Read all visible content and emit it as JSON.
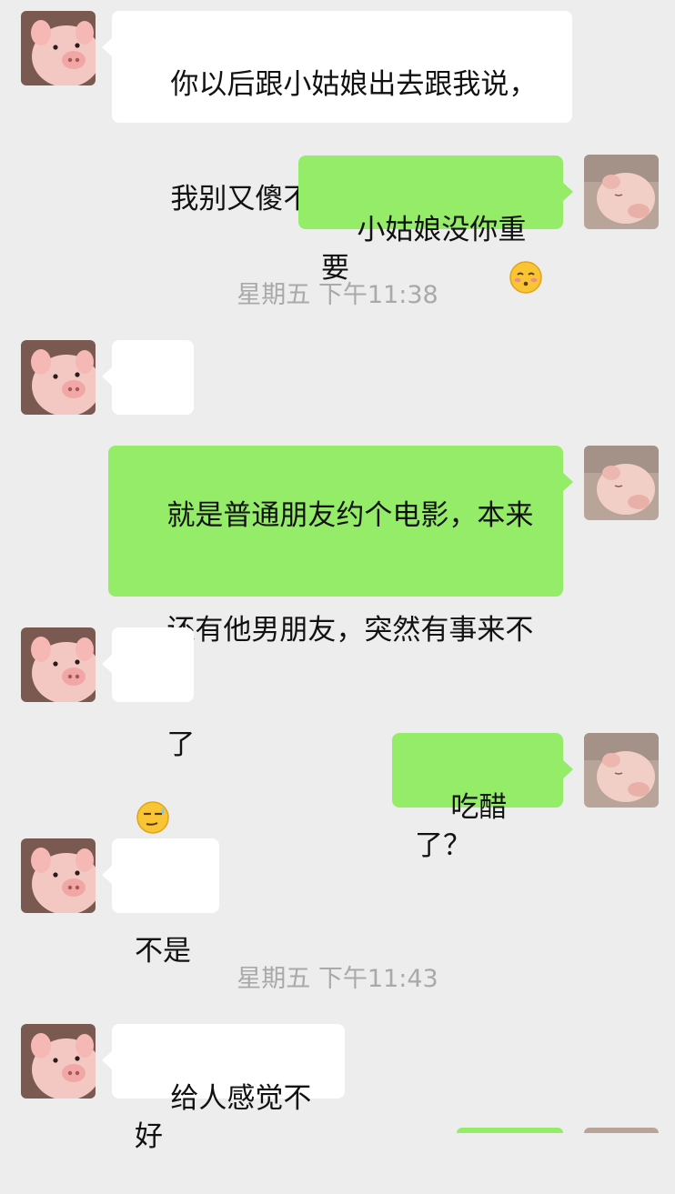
{
  "messages": [
    {
      "side": "in",
      "text_line1": "你以后跟小姑娘出去跟我说，",
      "text_line2": "我别又傻不唧了把你拉走了",
      "trailing_emoji": "smiling-blush-emoji"
    },
    {
      "side": "out",
      "text": "小姑娘没你重要"
    },
    {
      "timestamp": "星期五 下午11:38"
    },
    {
      "side": "in",
      "sticker": "smirk-sweat-emoji"
    },
    {
      "side": "out",
      "text_line1": "就是普通朋友约个电影，本来",
      "text_line2": "还有他男朋友，突然有事来不",
      "text_line3": "了"
    },
    {
      "side": "in",
      "sticker": "smirk-sweat-emoji"
    },
    {
      "side": "out",
      "text": "吃醋了？"
    },
    {
      "side": "in",
      "text": "不是"
    },
    {
      "timestamp": "星期五 下午11:43"
    },
    {
      "side": "in",
      "text": "给人感觉不好"
    }
  ],
  "colors": {
    "background": "#ededed",
    "incoming_bubble": "#ffffff",
    "outgoing_bubble": "#95ec69",
    "timestamp_text": "#a9a9a9"
  },
  "avatars": {
    "left": "pink-piglet-avatar-icon",
    "right": "sleeping-piglet-avatar-icon"
  }
}
